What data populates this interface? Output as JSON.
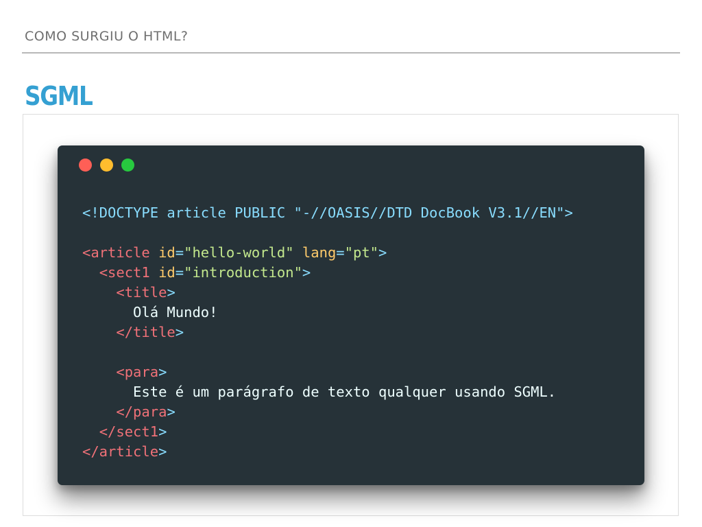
{
  "header": {
    "title": "COMO SURGIU O HTML?"
  },
  "slide": {
    "heading": "SGML"
  },
  "code_window": {
    "dot_colors": [
      "#ff5f56",
      "#ffbd2e",
      "#27c93f"
    ],
    "background": "#263238",
    "lines": [
      [
        {
          "t": "doctype",
          "v": "<!DOCTYPE article PUBLIC \"-//OASIS//DTD DocBook V3.1//EN\">"
        }
      ],
      [],
      [
        {
          "t": "tag",
          "v": "<article "
        },
        {
          "t": "attr",
          "v": "id"
        },
        {
          "t": "punct",
          "v": "="
        },
        {
          "t": "string",
          "v": "\"hello-world\""
        },
        {
          "t": "text",
          "v": " "
        },
        {
          "t": "attr",
          "v": "lang"
        },
        {
          "t": "punct",
          "v": "="
        },
        {
          "t": "string",
          "v": "\"pt\""
        },
        {
          "t": "punct",
          "v": ">"
        }
      ],
      [
        {
          "t": "text",
          "v": "  "
        },
        {
          "t": "tag",
          "v": "<sect1 "
        },
        {
          "t": "attr",
          "v": "id"
        },
        {
          "t": "punct",
          "v": "="
        },
        {
          "t": "string",
          "v": "\"introduction\""
        },
        {
          "t": "punct",
          "v": ">"
        }
      ],
      [
        {
          "t": "text",
          "v": "    "
        },
        {
          "t": "tag",
          "v": "<title"
        },
        {
          "t": "punct",
          "v": ">"
        }
      ],
      [
        {
          "t": "text",
          "v": "      Olá Mundo!"
        }
      ],
      [
        {
          "t": "text",
          "v": "    "
        },
        {
          "t": "tag",
          "v": "</title"
        },
        {
          "t": "punct",
          "v": ">"
        }
      ],
      [],
      [
        {
          "t": "text",
          "v": "    "
        },
        {
          "t": "tag",
          "v": "<para"
        },
        {
          "t": "punct",
          "v": ">"
        }
      ],
      [
        {
          "t": "text",
          "v": "      Este é um parágrafo de texto qualquer usando SGML."
        }
      ],
      [
        {
          "t": "text",
          "v": "    "
        },
        {
          "t": "tag",
          "v": "</para"
        },
        {
          "t": "punct",
          "v": ">"
        }
      ],
      [
        {
          "t": "text",
          "v": "  "
        },
        {
          "t": "tag",
          "v": "</sect1"
        },
        {
          "t": "punct",
          "v": ">"
        }
      ],
      [
        {
          "t": "tag",
          "v": "</article"
        },
        {
          "t": "punct",
          "v": ">"
        }
      ]
    ]
  }
}
